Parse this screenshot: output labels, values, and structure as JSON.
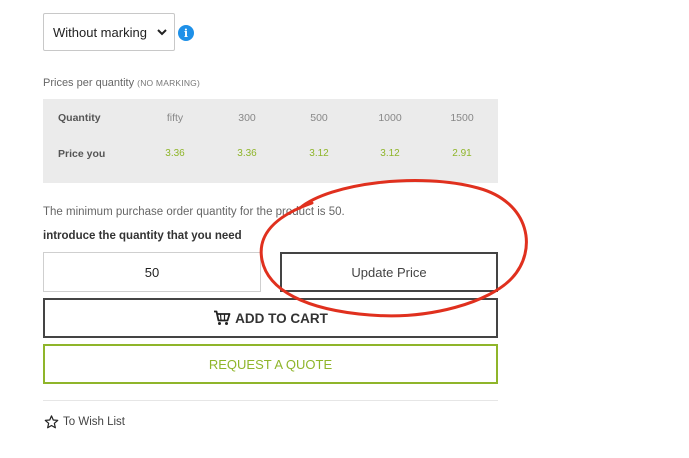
{
  "marking": {
    "selected": "Without marking"
  },
  "prices": {
    "caption": "Prices per quantity",
    "caption_note": "(NO MARKING)",
    "quantity_header": "Quantity",
    "price_header": "Price you",
    "columns": [
      {
        "qty": "fifty",
        "price": "3.36"
      },
      {
        "qty": "300",
        "price": "3.36"
      },
      {
        "qty": "500",
        "price": "3.12"
      },
      {
        "qty": "1000",
        "price": "3.12"
      },
      {
        "qty": "1500",
        "price": "2.91"
      }
    ]
  },
  "order": {
    "minimum_text": "The minimum purchase order quantity for the product is 50.",
    "intro_text": "introduce the quantity that you need",
    "quantity_value": "50",
    "update_label": "Update Price",
    "cart_label": "ADD TO CART",
    "quote_label": "REQUEST A QUOTE",
    "wishlist_label": "To Wish List"
  },
  "colors": {
    "accent_green": "#8fb52a",
    "info_blue": "#1e90e8",
    "annotation_red": "#e0301e"
  },
  "icons": {
    "info": "info-icon",
    "cart": "cart-icon",
    "wishlist": "star-outline-icon",
    "select": "chevron-down-icon"
  }
}
